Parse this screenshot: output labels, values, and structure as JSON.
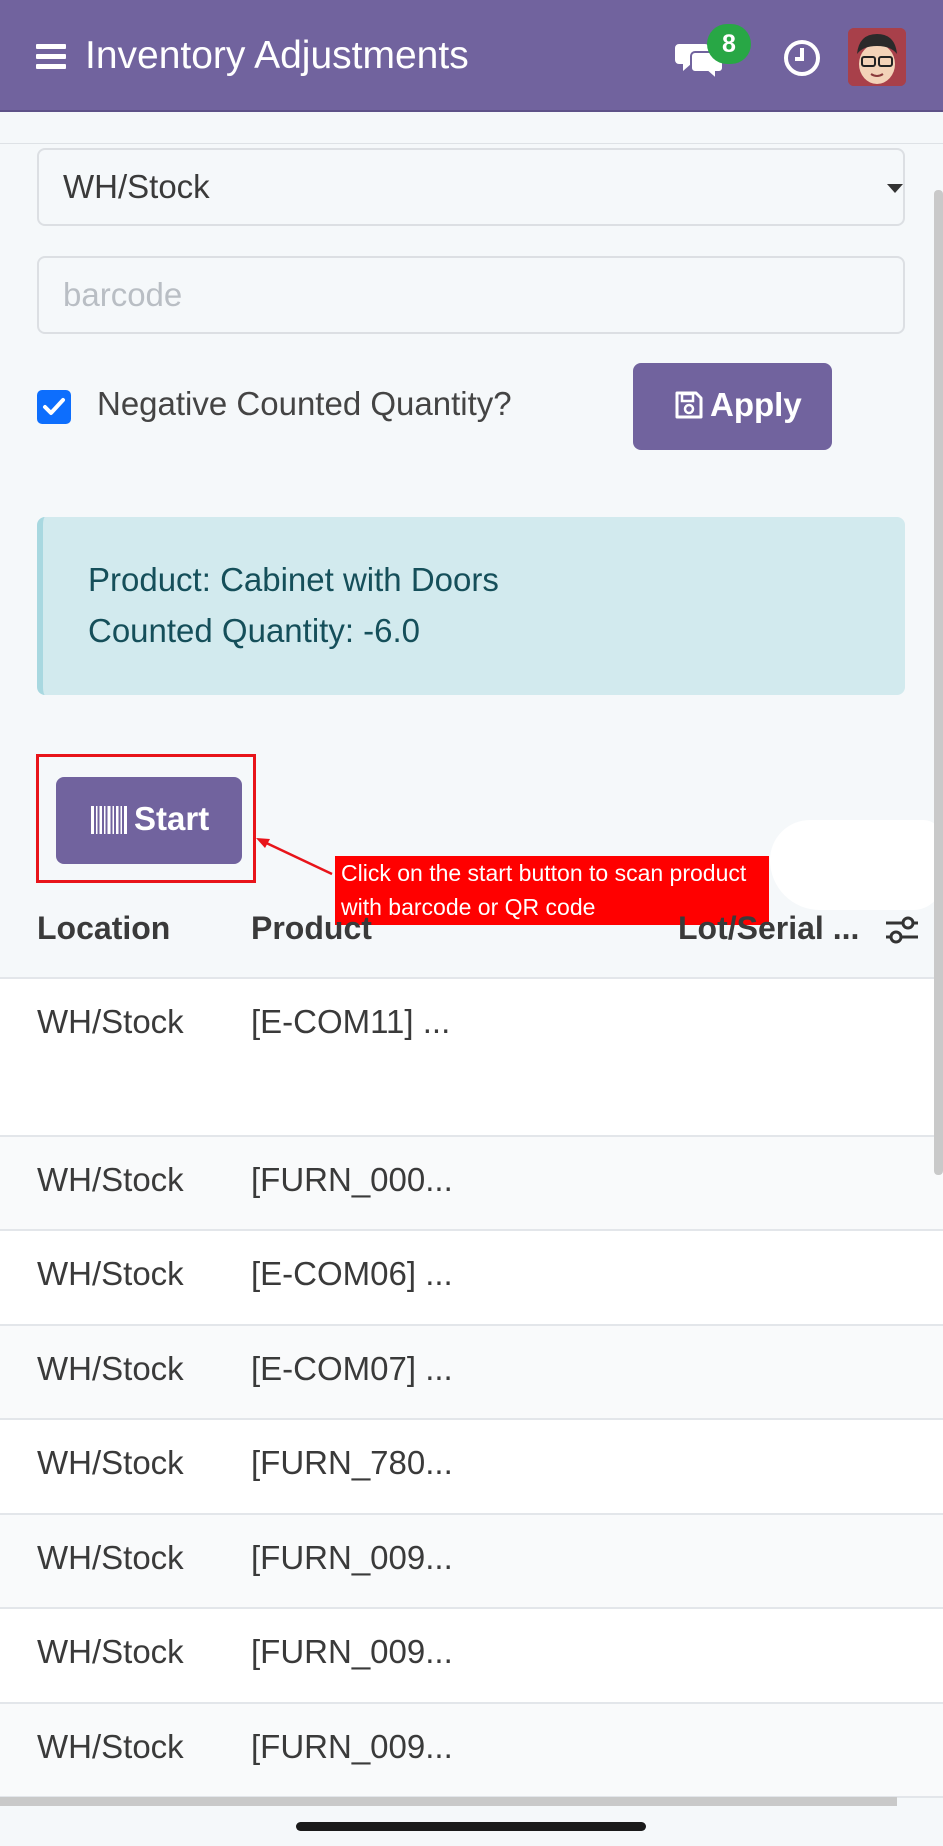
{
  "header": {
    "title": "Inventory Adjustments",
    "chat_badge": "8",
    "icons": [
      "hamburger-menu-icon",
      "chat-icon",
      "clock-icon",
      "avatar"
    ]
  },
  "form": {
    "location_value": "WH/Stock",
    "barcode_placeholder": "barcode",
    "barcode_value": "",
    "negative_label": "Negative Counted Quantity?",
    "negative_checked": true,
    "apply_label": "Apply"
  },
  "info": {
    "product_line": "Product: Cabinet with Doors",
    "qty_line": "Counted Quantity: -6.0"
  },
  "start_label": "Start",
  "callout": {
    "line1": "Click on the start button to scan product",
    "line2": "with barcode or QR code"
  },
  "table": {
    "columns": [
      "Location",
      "Product",
      "Lot/Serial ..."
    ],
    "rows": [
      {
        "location": "WH/Stock",
        "product": "[E-COM11] ..."
      },
      {
        "location": "WH/Stock",
        "product": "[FURN_000..."
      },
      {
        "location": "WH/Stock",
        "product": "[E-COM06] ..."
      },
      {
        "location": "WH/Stock",
        "product": "[E-COM07] ..."
      },
      {
        "location": "WH/Stock",
        "product": "[FURN_780..."
      },
      {
        "location": "WH/Stock",
        "product": "[FURN_009..."
      },
      {
        "location": "WH/Stock",
        "product": "[FURN_009..."
      },
      {
        "location": "WH/Stock",
        "product": "[FURN_009..."
      }
    ]
  },
  "colors": {
    "brand": "#71639e",
    "info_bg": "#d2eaee",
    "badge": "#28a745",
    "annotation": "#ff0000"
  }
}
